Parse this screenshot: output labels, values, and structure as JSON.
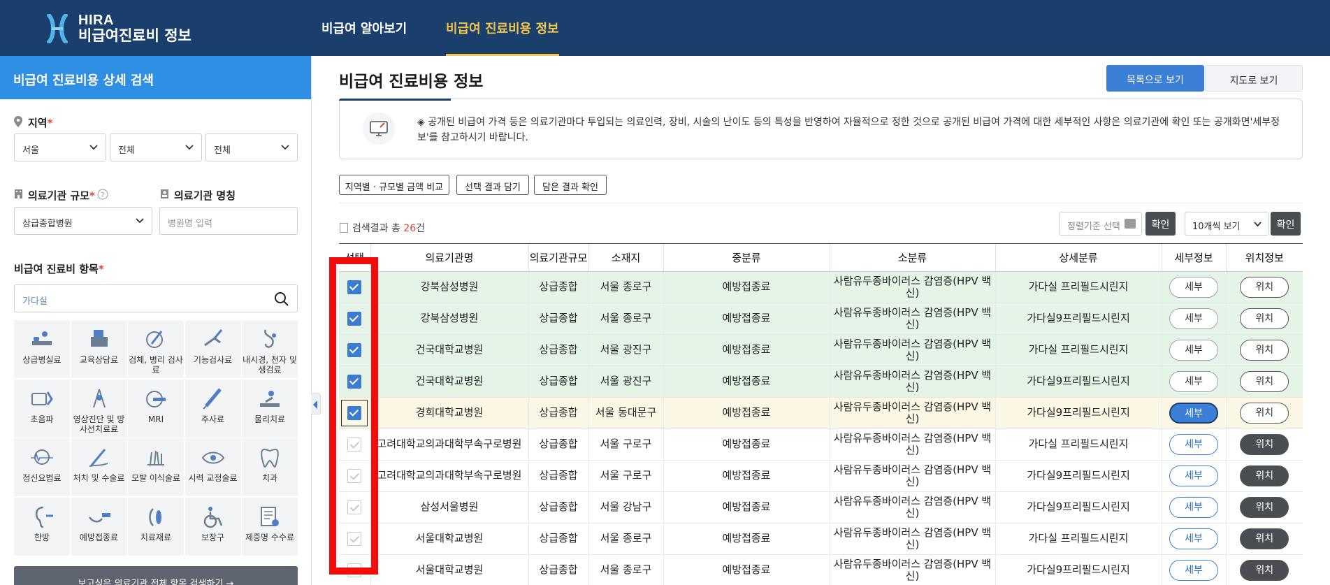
{
  "header": {
    "logo_line1": "HIRA",
    "logo_line2": "비급여진료비 정보",
    "nav": [
      "비급여 알아보기",
      "비급여 진료비용 정보"
    ]
  },
  "sidebar": {
    "title": "비급여 진료비용 상세 검색",
    "region_label": "지역",
    "region_selects": [
      "서울",
      "전체",
      "전체"
    ],
    "scale_label": "의료기관 규모",
    "scale_value": "상급종합병원",
    "name_label": "의료기관 명칭",
    "name_placeholder": "병원명 입력",
    "items_label": "비급여 진료비 항목",
    "item_search_value": "가다실",
    "categories": [
      "상급병실료",
      "교육상담료",
      "검체, 병리 검사료",
      "기능검사료",
      "내시경, 천자 및 생검료",
      "초음파",
      "영상진단 및 방사선치료료",
      "MRI",
      "주사료",
      "물리치료",
      "정신요법료",
      "처치 및 수술료",
      "모발 이식술료",
      "시력 교정술료",
      "치과",
      "한방",
      "예방접종료",
      "치료재료",
      "보장구",
      "제증명 수수료"
    ],
    "bottom_button": "보고싶은 의료기관 전체 항목 검색하기 →"
  },
  "main": {
    "title": "비급여 진료비용 정보",
    "view_list": "목록으로 보기",
    "view_map": "지도로 보기",
    "notice": "◈ 공개된 비급여 가격 등은 의료기관마다 투입되는 의료인력, 장비, 시술의 난이도 등의 특성을 반영하여 자율적으로 정한 것으로 공개된 비급여 가격에 대한 세부적인 사항은 의료기관에 확인 또는 공개화면'세부정보'를 참고하시기 바랍니다.",
    "actions": [
      "지역별 · 규모별 금액 비교",
      "선택 결과 담기",
      "담은 결과 확인"
    ],
    "result_prefix": "검색결과 총",
    "result_count": "26",
    "result_suffix": "건",
    "sort_placeholder": "정렬기준 선택",
    "confirm": "확인",
    "per_page": "10개씩 보기"
  },
  "table": {
    "headers": [
      "선택",
      "의료기관명",
      "의료기관규모",
      "소재지",
      "중분류",
      "소분류",
      "상세분류",
      "세부정보",
      "위치정보"
    ],
    "detail_label": "세부",
    "location_label": "위치",
    "rows": [
      {
        "name": "강북삼성병원",
        "scale": "상급종합",
        "loc": "서울 종로구",
        "mid": "예방접종료",
        "sub": "사람유두종바이러스 감염증(HPV 백신)",
        "detail": "가다실 프리필드시린지",
        "checked": true
      },
      {
        "name": "강북삼성병원",
        "scale": "상급종합",
        "loc": "서울 종로구",
        "mid": "예방접종료",
        "sub": "사람유두종바이러스 감염증(HPV 백신)",
        "detail": "가다실9프리필드시린지",
        "checked": true
      },
      {
        "name": "건국대학교병원",
        "scale": "상급종합",
        "loc": "서울 광진구",
        "mid": "예방접종료",
        "sub": "사람유두종바이러스 감염증(HPV 백신)",
        "detail": "가다실 프리필드시린지",
        "checked": true
      },
      {
        "name": "건국대학교병원",
        "scale": "상급종합",
        "loc": "서울 광진구",
        "mid": "예방접종료",
        "sub": "사람유두종바이러스 감염증(HPV 백신)",
        "detail": "가다실9프리필드시린지",
        "checked": true
      },
      {
        "name": "경희대학교병원",
        "scale": "상급종합",
        "loc": "서울 동대문구",
        "mid": "예방접종료",
        "sub": "사람유두종바이러스 감염증(HPV 백신)",
        "detail": "가다실9프리필드시린지",
        "checked": true
      },
      {
        "name": "고려대학교의과대학부속구로병원",
        "scale": "상급종합",
        "loc": "서울 구로구",
        "mid": "예방접종료",
        "sub": "사람유두종바이러스 감염증(HPV 백신)",
        "detail": "가다실 프리필드시린지",
        "checked": false
      },
      {
        "name": "고려대학교의과대학부속구로병원",
        "scale": "상급종합",
        "loc": "서울 구로구",
        "mid": "예방접종료",
        "sub": "사람유두종바이러스 감염증(HPV 백신)",
        "detail": "가다실9프리필드시린지",
        "checked": false
      },
      {
        "name": "삼성서울병원",
        "scale": "상급종합",
        "loc": "서울 강남구",
        "mid": "예방접종료",
        "sub": "사람유두종바이러스 감염증(HPV 백신)",
        "detail": "가다실9프리필드시린지",
        "checked": false
      },
      {
        "name": "서울대학교병원",
        "scale": "상급종합",
        "loc": "서울 종로구",
        "mid": "예방접종료",
        "sub": "사람유두종바이러스 감염증(HPV 백신)",
        "detail": "가다실 프리필드시린지",
        "checked": false
      },
      {
        "name": "서울대학교병원",
        "scale": "상급종합",
        "loc": "서울 종로구",
        "mid": "예방접종료",
        "sub": "사람유두종바이러스 감염증(HPV 백신)",
        "detail": "가다실9프리필드시린지",
        "checked": false
      }
    ]
  },
  "colors": {
    "header_bg": "#1b3f6d",
    "accent_blue": "#2f8fe2",
    "active_nav": "#f3c44a",
    "selected_row": "#e6f4e8",
    "highlight_row": "#fcf7e4",
    "annotation_red": "#f20c0c"
  }
}
